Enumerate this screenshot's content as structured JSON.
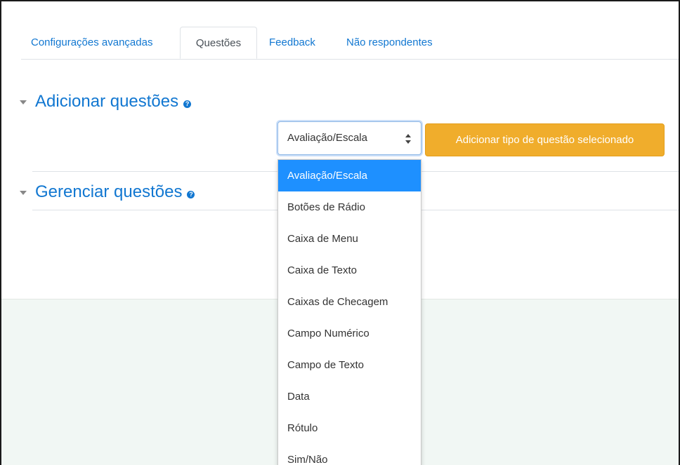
{
  "tabs": [
    {
      "label": "Configurações avançadas"
    },
    {
      "label": "Questões",
      "active": true
    },
    {
      "label": "Feedback"
    },
    {
      "label": "Não respondentes"
    }
  ],
  "sections": {
    "add": {
      "title": "Adicionar questões"
    },
    "manage": {
      "title": "Gerenciar questões"
    }
  },
  "help_icon_glyph": "?",
  "question_type_select": {
    "value": "Avaliação/Escala",
    "options": [
      "Avaliação/Escala",
      "Botões de Rádio",
      "Caixa de Menu",
      "Caixa de Texto",
      "Caixas de Checagem",
      "Campo Numérico",
      "Campo de Texto",
      "Data",
      "Rótulo",
      "Sim/Não"
    ]
  },
  "add_button_label": "Adicionar tipo de questão selecionado",
  "colors": {
    "link": "#1177d1",
    "button": "#f0ad2c",
    "selected_option": "#1e90ff",
    "footer_bg": "#f1f7f4"
  }
}
